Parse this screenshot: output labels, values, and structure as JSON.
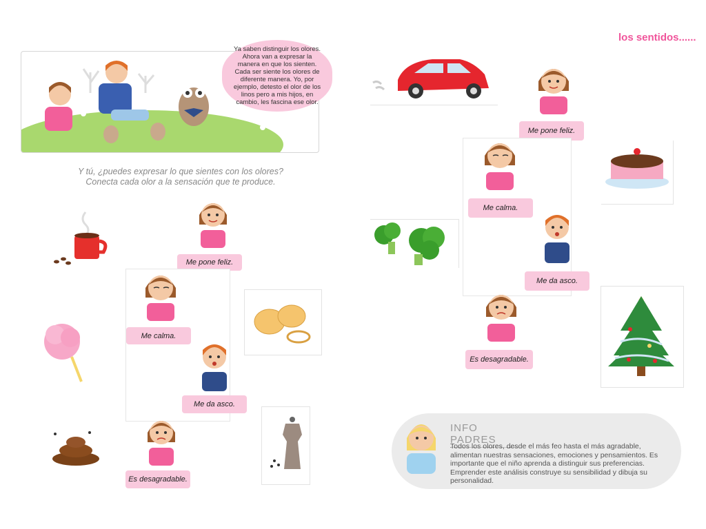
{
  "header": {
    "title": "los sentidos"
  },
  "story": {
    "speech_text": "Ya saben distinguir los olores. Ahora van a expresar la manera en que los sienten. Cada ser siente los olores de diferente manera. Yo, por ejemplo, detesto el olor de los linos pero a mis hijos, en cambio, les fascina ese olor."
  },
  "instructions": {
    "line1": "Y tú, ¿puedes expresar lo que sientes con los olores?",
    "line2": "Conecta cada olor a la sensación que te produce."
  },
  "left_activity": {
    "smells": [
      "coffee-cup",
      "cotton-candy",
      "poop",
      "onions",
      "pepper-mill"
    ],
    "feelings": [
      "Me pone feliz.",
      "Me calma.",
      "Me da asco.",
      "Es desagradable."
    ]
  },
  "right_activity": {
    "smells": [
      "red-car",
      "broccoli",
      "cake",
      "christmas-tree"
    ],
    "feelings": [
      "Me pone feliz.",
      "Me calma.",
      "Me da asco.",
      "Es desagradable."
    ]
  },
  "info": {
    "title": "INFO PADRES",
    "text": "Todos los olores, desde el más feo hasta el más agradable, alimentan nuestras sensaciones, emociones y pensamientos. Es importante que el niño aprenda a distinguir sus preferencias. Emprender este análisis construye su sensibilidad y dibuja su personalidad."
  },
  "colors": {
    "pink": "#f9c9dd",
    "title_pink": "#f0559b",
    "grass": "#a9d86e"
  }
}
